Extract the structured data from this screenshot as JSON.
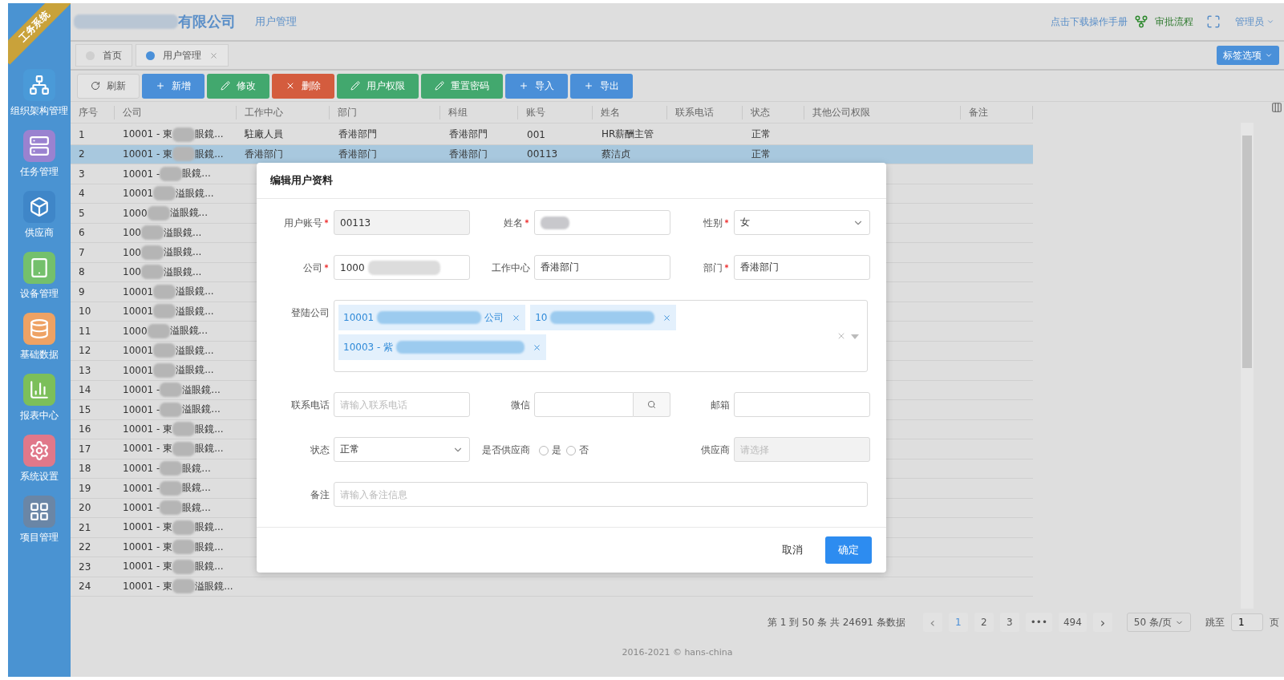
{
  "sidebar": {
    "ribbon": "工务系统",
    "items": [
      {
        "kind": "network",
        "label": "组织架构管理",
        "color": "#4a9ad8"
      },
      {
        "kind": "server",
        "label": "任务管理",
        "color": "#9a82d0"
      },
      {
        "kind": "box",
        "label": "供应商",
        "color": "#3f86c8"
      },
      {
        "kind": "tablet",
        "label": "设备管理",
        "color": "#74c06c"
      },
      {
        "kind": "database",
        "label": "基础数据",
        "color": "#eea264"
      },
      {
        "kind": "chart",
        "label": "报表中心",
        "color": "#7cbf5a"
      },
      {
        "kind": "settings",
        "label": "系统设置",
        "color": "#e0788a"
      },
      {
        "kind": "grid",
        "label": "项目管理",
        "color": "#6a86a6"
      }
    ]
  },
  "header": {
    "company": "有限公司",
    "page": "用户管理",
    "manual_link": "点击下载操作手册",
    "workflow": "审批流程",
    "user": "管理员"
  },
  "tabs": [
    {
      "label": "首页",
      "selected": false,
      "closable": false
    },
    {
      "label": "用户管理",
      "selected": true,
      "closable": true
    }
  ],
  "tab_options": "标签选项",
  "toolbar": [
    {
      "label": "刷新",
      "kind": "refresh"
    },
    {
      "label": "新增",
      "kind": "add"
    },
    {
      "label": "修改",
      "kind": "edit"
    },
    {
      "label": "删除",
      "kind": "delete"
    },
    {
      "label": "用户权限",
      "kind": "edit"
    },
    {
      "label": "重置密码",
      "kind": "edit"
    },
    {
      "label": "导入",
      "kind": "add"
    },
    {
      "label": "导出",
      "kind": "add"
    }
  ],
  "table": {
    "columns": [
      "序号",
      "公司",
      "工作中心",
      "部门",
      "科组",
      "账号",
      "姓名",
      "联系电话",
      "状态",
      "其他公司权限",
      "备注"
    ],
    "rows": [
      {
        "no": "1",
        "company_start": "10001 - 東",
        "company_end": "眼鏡...",
        "work_center": "駐廠人員",
        "dept": "香港部門",
        "group": "香港部門",
        "account": "001",
        "name": "HR薪酬主管",
        "status": "正常",
        "selected": false
      },
      {
        "no": "2",
        "company_start": "10001 - 東",
        "company_end": "眼鏡...",
        "work_center": "香港部门",
        "dept": "香港部门",
        "group": "香港部门",
        "account": "00113",
        "name": "蔡洁贞",
        "status": "正常",
        "selected": true
      },
      {
        "no": "3",
        "company_start": "10001 -",
        "company_end": "眼鏡...",
        "selected": false
      },
      {
        "no": "4",
        "company_start": "10001",
        "company_end": "溢眼鏡...",
        "selected": false
      },
      {
        "no": "5",
        "company_start": "1000",
        "company_end": "溢眼鏡...",
        "selected": false
      },
      {
        "no": "6",
        "company_start": "100",
        "company_end": "溢眼鏡...",
        "selected": false
      },
      {
        "no": "7",
        "company_start": "100",
        "company_end": "溢眼鏡...",
        "selected": false
      },
      {
        "no": "8",
        "company_start": "100",
        "company_end": "溢眼鏡...",
        "selected": false
      },
      {
        "no": "9",
        "company_start": "10001",
        "company_end": "溢眼鏡...",
        "selected": false
      },
      {
        "no": "10",
        "company_start": "10001",
        "company_end": "溢眼鏡...",
        "selected": false
      },
      {
        "no": "11",
        "company_start": "1000",
        "company_end": "溢眼鏡...",
        "selected": false
      },
      {
        "no": "12",
        "company_start": "10001",
        "company_end": "溢眼鏡...",
        "selected": false
      },
      {
        "no": "13",
        "company_start": "10001",
        "company_end": "溢眼鏡...",
        "selected": false
      },
      {
        "no": "14",
        "company_start": "10001 -",
        "company_end": "溢眼鏡...",
        "selected": false
      },
      {
        "no": "15",
        "company_start": "10001 -",
        "company_end": "溢眼鏡...",
        "selected": false
      },
      {
        "no": "16",
        "company_start": "10001 - 東",
        "company_end": "眼鏡...",
        "selected": false
      },
      {
        "no": "17",
        "company_start": "10001 - 東",
        "company_end": "眼鏡...",
        "selected": false
      },
      {
        "no": "18",
        "company_start": "10001 -",
        "company_end": "眼鏡...",
        "selected": false
      },
      {
        "no": "19",
        "company_start": "10001 -",
        "company_end": "眼鏡...",
        "selected": false
      },
      {
        "no": "20",
        "company_start": "10001 -",
        "company_end": "眼鏡...",
        "selected": false
      },
      {
        "no": "21",
        "company_start": "10001 - 東",
        "company_end": "眼鏡...",
        "selected": false
      },
      {
        "no": "22",
        "company_start": "10001 - 東",
        "company_end": "眼鏡...",
        "selected": false
      },
      {
        "no": "23",
        "company_start": "10001 - 東",
        "company_end": "眼鏡...",
        "selected": false
      },
      {
        "no": "24",
        "company_start": "10001 - 東",
        "company_end": "溢眼鏡...",
        "selected": false
      }
    ]
  },
  "pagination": {
    "summary": "第 1 到 50 条 共 24691 条数据",
    "prev": "‹",
    "pages": [
      {
        "label": "1",
        "selected": true
      },
      {
        "label": "2",
        "selected": false
      },
      {
        "label": "3",
        "selected": false
      },
      {
        "label": "•••",
        "selected": false
      },
      {
        "label": "494",
        "selected": false
      }
    ],
    "next": "›",
    "page_size": "50 条/页",
    "jump_label": "跳至",
    "jump_value": "1",
    "page_unit": "页"
  },
  "footer": "2016-2021 © hans-china",
  "dialog": {
    "title": "编辑用户资料",
    "rows": [
      [
        {
          "label": "用户账号",
          "required": true,
          "kind": "input",
          "value": "00113",
          "disabled": true
        },
        {
          "label": "姓名",
          "required": true,
          "kind": "blurred"
        },
        {
          "label": "性别",
          "required": true,
          "kind": "select",
          "value": "女"
        }
      ],
      [
        {
          "label": "公司",
          "required": true,
          "kind": "blurred-select",
          "value": "1000"
        },
        {
          "label": "工作中心",
          "required": false,
          "kind": "input",
          "value": "香港部门",
          "disabled": false
        },
        {
          "label": "部门",
          "required": true,
          "kind": "input",
          "value": "香港部门",
          "disabled": false
        }
      ],
      [
        {
          "label": "登陆公司",
          "required": false,
          "kind": "tags",
          "tags": [
            {
              "start": "10001",
              "end": "公司"
            },
            {
              "start": "10"
            },
            {
              "start": "10003 - 紫"
            }
          ]
        }
      ],
      [
        {
          "label": "联系电话",
          "required": false,
          "kind": "input",
          "placeholder": "请输入联系电话",
          "disabled": false
        },
        {
          "label": "微信",
          "required": false,
          "kind": "search"
        },
        {
          "label": "邮箱",
          "required": false,
          "kind": "input",
          "disabled": false
        }
      ],
      [
        {
          "label": "状态",
          "required": false,
          "kind": "select",
          "value": "正常"
        },
        {
          "label": "是否供应商",
          "required": false,
          "kind": "radio",
          "options": [
            {
              "label": "是",
              "selected": false
            },
            {
              "label": "否",
              "selected": false
            }
          ]
        },
        {
          "label": "供应商",
          "required": false,
          "kind": "input",
          "placeholder": "请选择",
          "disabled": true
        }
      ],
      [
        {
          "label": "备注",
          "required": false,
          "kind": "wide-input",
          "placeholder": "请输入备注信息"
        }
      ]
    ],
    "cancel": "取消",
    "confirm": "确定"
  }
}
